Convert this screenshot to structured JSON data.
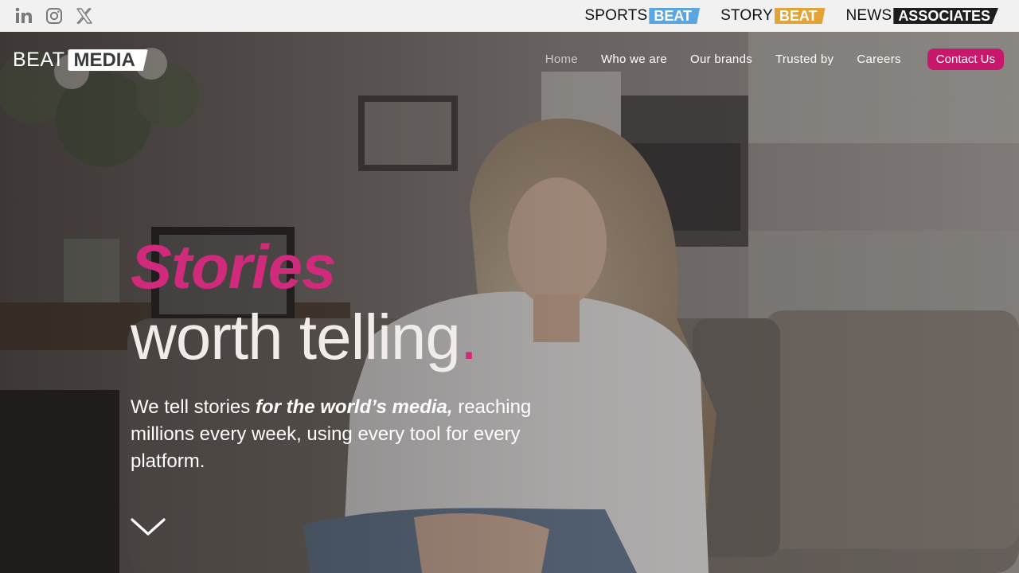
{
  "topbar": {
    "social": [
      {
        "icon": "linkedin-icon"
      },
      {
        "icon": "instagram-icon"
      },
      {
        "icon": "x-twitter-icon"
      }
    ],
    "brands": [
      {
        "word1": "SPORTS",
        "word2": "BEAT",
        "color": "#5aa6e0"
      },
      {
        "word1": "STORY",
        "word2": "BEAT",
        "color": "#e2a337"
      },
      {
        "word1": "NEWS",
        "word2": "ASSOCIATES",
        "color": "#1e1e1e"
      }
    ]
  },
  "nav": {
    "logo": {
      "word1": "BEAT",
      "word2": "MEDIA"
    },
    "items": [
      "Home",
      "Who we are",
      "Our brands",
      "Trusted by",
      "Careers"
    ],
    "active": "Home",
    "contact_label": "Contact Us"
  },
  "hero": {
    "headline_accent": "Stories",
    "headline_main": "worth telling",
    "headline_dot": ".",
    "lead_before": "We tell stories ",
    "lead_emphasis": "for the world’s media,",
    "lead_after": " reaching millions every week, using every tool for every platform.",
    "scroll_icon": "chevron-down-icon"
  },
  "colors": {
    "accent": "#c8186c",
    "headline_accent": "#cf2a7c"
  }
}
